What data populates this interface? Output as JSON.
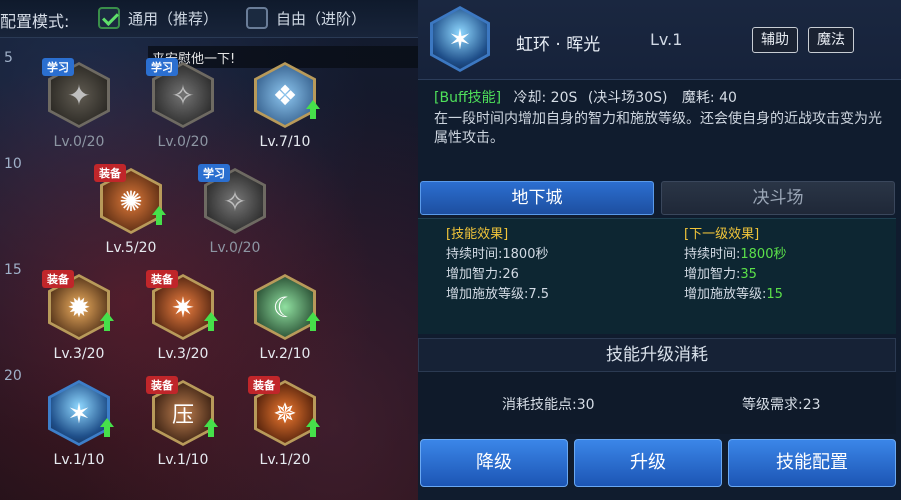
{
  "top_bar": {
    "mode_label": "配置模式:",
    "general_label": "通用（推荐）",
    "free_label": "自由（进阶）"
  },
  "level_axis": [
    "5",
    "10",
    "15",
    "20"
  ],
  "chat_message": "来安慰他一下!",
  "skills": [
    {
      "tag": "学习",
      "level": "Lv.0/20",
      "glyph": "✦",
      "upgradable": false
    },
    {
      "tag": "学习",
      "level": "Lv.0/20",
      "glyph": "✧",
      "upgradable": false
    },
    {
      "tag": "",
      "level": "Lv.7/10",
      "glyph": "❖",
      "upgradable": true
    },
    {
      "tag": "装备",
      "level": "Lv.5/20",
      "glyph": "✺",
      "upgradable": true
    },
    {
      "tag": "学习",
      "level": "Lv.0/20",
      "glyph": "✧",
      "upgradable": false
    },
    {
      "tag": "装备",
      "level": "Lv.3/20",
      "glyph": "✹",
      "upgradable": true
    },
    {
      "tag": "装备",
      "level": "Lv.3/20",
      "glyph": "✷",
      "upgradable": true
    },
    {
      "tag": "",
      "level": "Lv.2/10",
      "glyph": "☾",
      "upgradable": true
    },
    {
      "tag": "",
      "level": "Lv.1/10",
      "glyph": "✶",
      "upgradable": true
    },
    {
      "tag": "装备",
      "level": "Lv.1/10",
      "glyph": "压",
      "upgradable": true
    },
    {
      "tag": "装备",
      "level": "Lv.1/20",
      "glyph": "✵",
      "upgradable": true
    }
  ],
  "detail": {
    "name": "虹环 · 晖光",
    "level": "Lv.1",
    "tags": [
      "辅助",
      "魔法"
    ],
    "type": "[Buff技能]",
    "cooldown": "冷却: 20S",
    "pvp_cooldown": "(决斗场30S)",
    "mana": "魔耗: 40",
    "description": "在一段时间内增加自身的智力和施放等级。还会使自身的近战攻击变为光属性攻击。"
  },
  "tabs": {
    "dungeon": "地下城",
    "arena": "决斗场"
  },
  "effects": {
    "current": {
      "title": "[技能效果]",
      "duration_label": "持续时间:",
      "duration": "1800秒",
      "int_label": "增加智力:",
      "int": "26",
      "cast_label": "增加施放等级:",
      "cast": "7.5"
    },
    "next": {
      "title": "[下一级效果]",
      "duration_label": "持续时间:",
      "duration": "1800秒",
      "int_label": "增加智力:",
      "int": "35",
      "cast_label": "增加施放等级:",
      "cast": "15"
    }
  },
  "cost": {
    "title": "技能升级消耗",
    "sp": "消耗技能点:30",
    "level_req": "等级需求:23"
  },
  "actions": {
    "downgrade": "降级",
    "upgrade": "升级",
    "config": "技能配置"
  },
  "colors": {
    "accent": "#2c6fd0",
    "buff_green": "#4ee05a",
    "effect_yellow": "#f0c43a",
    "equip_red": "#c0262a",
    "learn_blue": "#2b6fd0"
  }
}
